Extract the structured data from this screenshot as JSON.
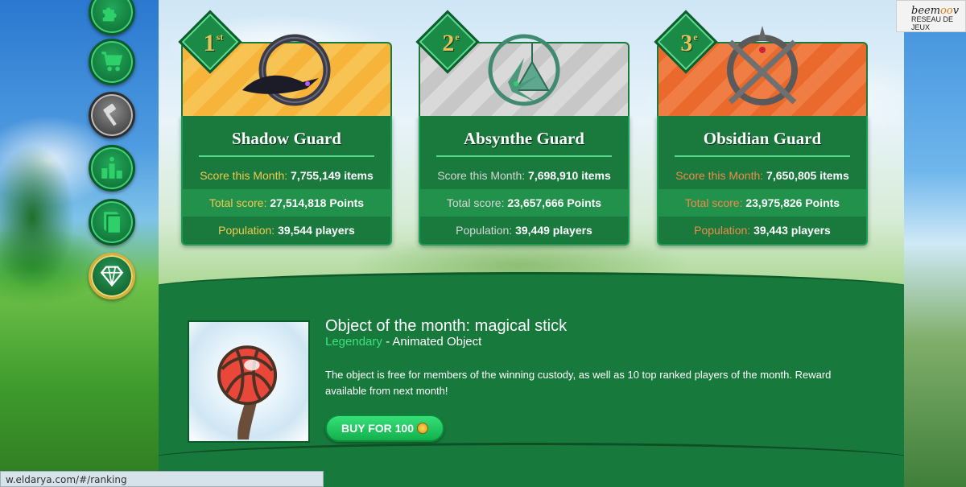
{
  "sidebar": {
    "items": [
      {
        "name": "puzzle",
        "icon": "puzzle-icon"
      },
      {
        "name": "shop",
        "icon": "cart-icon"
      },
      {
        "name": "auction",
        "icon": "gavel-icon"
      },
      {
        "name": "ranking",
        "icon": "podium-icon"
      },
      {
        "name": "book",
        "icon": "book-icon"
      },
      {
        "name": "diamond",
        "icon": "diamond-icon"
      }
    ]
  },
  "guards": [
    {
      "rank": "1",
      "rank_suffix": "st",
      "name": "Shadow Guard",
      "month_label": "Score this Month:",
      "month_value": "7,755,149 items",
      "total_label": "Total score:",
      "total_value": "27,514,818 Points",
      "pop_label": "Population:",
      "pop_value": "39,544 players"
    },
    {
      "rank": "2",
      "rank_suffix": "e",
      "name": "Absynthe Guard",
      "month_label": "Score this Month:",
      "month_value": "7,698,910 items",
      "total_label": "Total score:",
      "total_value": "23,657,666 Points",
      "pop_label": "Population:",
      "pop_value": "39,449 players"
    },
    {
      "rank": "3",
      "rank_suffix": "e",
      "name": "Obsidian Guard",
      "month_label": "Score this Month:",
      "month_value": "7,650,805 items",
      "total_label": "Total score:",
      "total_value": "23,975,826 Points",
      "pop_label": "Population:",
      "pop_value": "39,443 players"
    }
  ],
  "object": {
    "title": "Object of the month: magical stick",
    "rarity": "Legendary",
    "type": " - Animated Object",
    "description": "The object is free for members of the winning custody, as well as 10 top ranked players of the month. Reward available from next month!",
    "buy_label": "BUY FOR 100"
  },
  "status_bar": {
    "url": "w.eldarya.com/#/ranking"
  },
  "beemoov": {
    "brand_a": "beem",
    "brand_o": "oo",
    "brand_b": "v",
    "tagline": "RESEAU DE JEUX"
  },
  "colors": {
    "gold": "#f6b53a",
    "silver": "#c7c7c7",
    "bronze": "#ea6a2e",
    "panel_green": "#18793c"
  }
}
